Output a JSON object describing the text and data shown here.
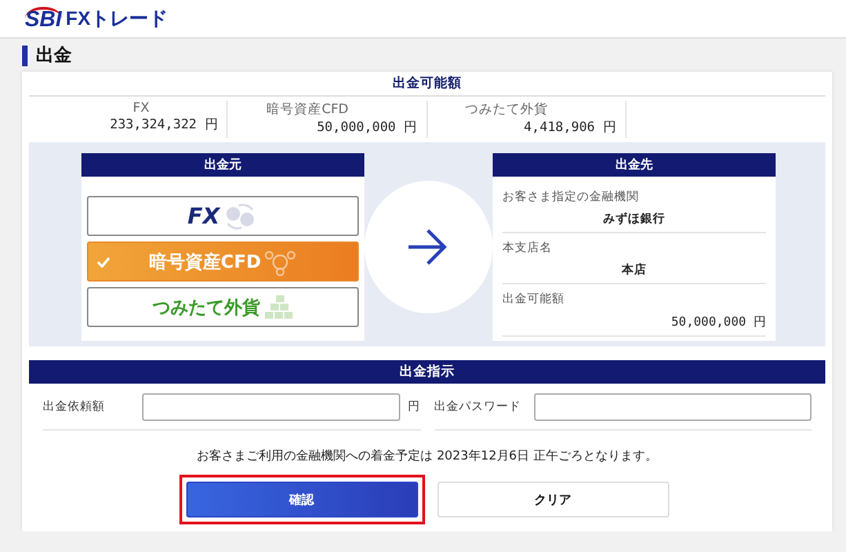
{
  "header": {
    "logo_mark": "SBI",
    "logo_text": "FXトレード"
  },
  "page_title": "出金",
  "available": {
    "title": "出金可能額",
    "items": [
      {
        "label": "FX",
        "amount": "233,324,322",
        "unit": "円"
      },
      {
        "label": "暗号資産CFD",
        "amount": "50,000,000",
        "unit": "円"
      },
      {
        "label": "つみたて外貨",
        "amount": "4,418,906",
        "unit": "円"
      }
    ]
  },
  "source": {
    "title": "出金元",
    "options": [
      {
        "kind": "fx",
        "label": "FX",
        "selected": false
      },
      {
        "kind": "crypto",
        "label": "暗号資産CFD",
        "selected": true
      },
      {
        "kind": "tsumitate",
        "label": "つみたて外貨",
        "selected": false
      }
    ]
  },
  "destination": {
    "title": "出金先",
    "rows": [
      {
        "label": "お客さま指定の金融機関",
        "value": "みずほ銀行"
      },
      {
        "label": "本支店名",
        "value": "本店"
      },
      {
        "label": "出金可能額",
        "value": "50,000,000",
        "unit": "円"
      }
    ]
  },
  "instruction": {
    "title": "出金指示",
    "amount_label": "出金依頼額",
    "amount_unit": "円",
    "password_label": "出金パスワード"
  },
  "notice": "お客さまご利用の金融機関への着金予定は 2023年12月6日 正午ごろとなります。",
  "buttons": [
    {
      "kind": "primary",
      "label": "確認",
      "highlighted": true
    },
    {
      "kind": "secondary",
      "label": "クリア",
      "highlighted": false
    }
  ]
}
